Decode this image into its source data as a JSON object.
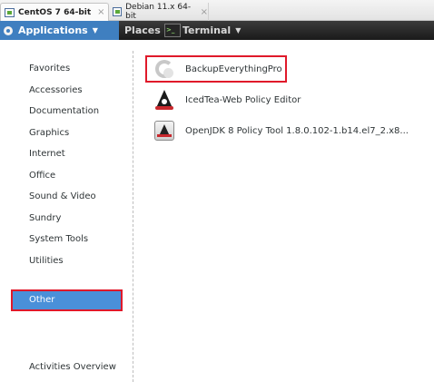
{
  "vm_tabs": [
    {
      "label": "CentOS 7 64-bit",
      "close": "×"
    },
    {
      "label": "Debian 11.x 64-bit",
      "close": "×"
    }
  ],
  "topbar": {
    "applications_label": "Applications",
    "places_label": "Places",
    "terminal_label": "Terminal",
    "arrow": "▼",
    "terminal_icon_text": ">_"
  },
  "categories": [
    {
      "label": "Favorites"
    },
    {
      "label": "Accessories"
    },
    {
      "label": "Documentation"
    },
    {
      "label": "Graphics"
    },
    {
      "label": "Internet"
    },
    {
      "label": "Office"
    },
    {
      "label": "Sound & Video"
    },
    {
      "label": "Sundry"
    },
    {
      "label": "System Tools"
    },
    {
      "label": "Utilities"
    }
  ],
  "selected_category": "Other",
  "activities_overview": "Activities Overview",
  "apps": [
    {
      "label": "BackupEverythingPro",
      "icon": "backup-icon"
    },
    {
      "label": "IcedTea-Web Policy Editor",
      "icon": "java-icon"
    },
    {
      "label": "OpenJDK 8 Policy Tool 1.8.0.102-1.b14.el7_2.x8...",
      "icon": "java-policy-icon"
    }
  ],
  "colors": {
    "highlight": "#e0192a",
    "selection": "#4a90d9",
    "applications_bg": "#3f7fc0"
  }
}
